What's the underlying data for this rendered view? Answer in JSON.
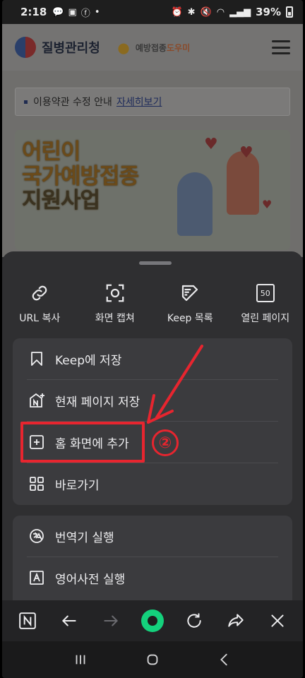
{
  "status_bar": {
    "time": "2:18",
    "battery": "39%"
  },
  "web_page": {
    "site_name": "질병관리청",
    "sub_site_name": "예방접종",
    "sub_site_accent": "도우미",
    "notice_text": "이용약관 수정 안내",
    "notice_link": "자세히보기",
    "banner_lines": [
      "어린이",
      "국가예방접종",
      "지원사업"
    ]
  },
  "quick_actions": [
    {
      "label": "URL 복사",
      "icon": "link-icon"
    },
    {
      "label": "화면 캡쳐",
      "icon": "capture-icon"
    },
    {
      "label": "Keep 목록",
      "icon": "keep-list-icon"
    },
    {
      "label": "열린 페이지",
      "icon": "open-pages-icon",
      "count": "50"
    }
  ],
  "menu_group_1": [
    {
      "label": "Keep에 저장",
      "icon": "bookmark-icon"
    },
    {
      "label": "현재 페이지 저장",
      "icon": "save-page-icon"
    },
    {
      "label": "홈 화면에 추가",
      "icon": "add-home-icon"
    },
    {
      "label": "바로가기",
      "icon": "grid-icon"
    }
  ],
  "menu_group_2": [
    {
      "label": "번역기 실행",
      "icon": "translate-icon"
    },
    {
      "label": "영어사전 실행",
      "icon": "dictionary-icon"
    }
  ],
  "annotation": {
    "step_number": "②",
    "color": "#e7252f"
  },
  "colors": {
    "sheet_bg": "#2f2f31",
    "card_bg": "#3b3b3e",
    "accent_green": "#14d17c"
  }
}
